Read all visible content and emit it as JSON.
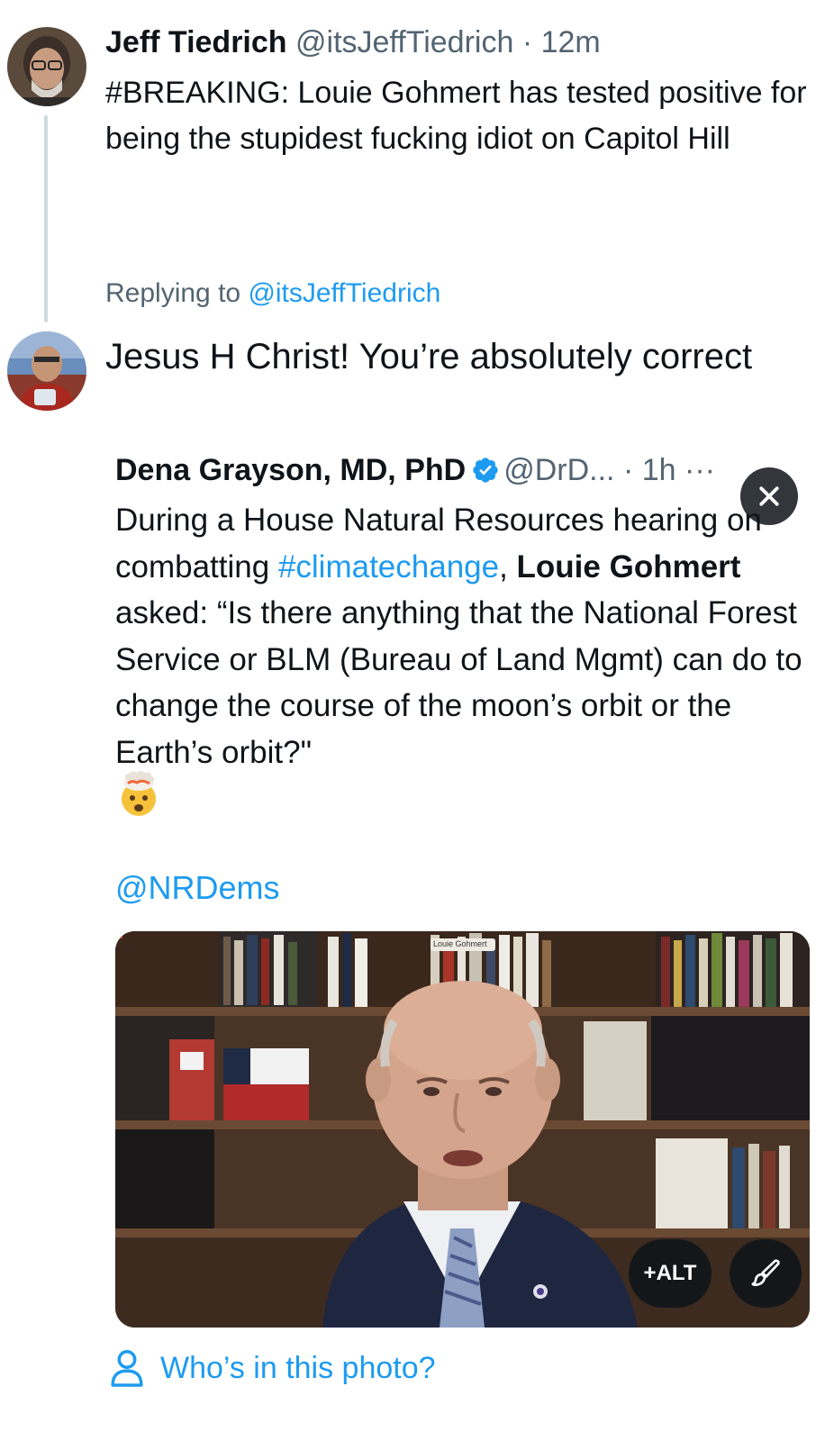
{
  "tweet": {
    "author_name": "Jeff Tiedrich",
    "author_handle": "@itsJeffTiedrich",
    "separator": "·",
    "time": "12m",
    "text": "#BREAKING: Louie Gohmert has tested positive for being the stupidest fucking idiot on Capitol Hill"
  },
  "reply": {
    "replying_prefix": "Replying to ",
    "replying_to": "@itsJeffTiedrich",
    "text": "Jesus H Christ! You’re absolutely correct"
  },
  "quote": {
    "author_name": "Dena Grayson, MD, PhD",
    "author_handle": "@DrD...",
    "separator": "·",
    "time": "1h",
    "more": "···",
    "text_part1": "During a House Natural Resources hearing on combatting ",
    "hashtag": "#climatechange",
    "text_part2": ", ",
    "bold_name": "Louie Gohmert",
    "text_part3": " asked: “Is there anything that the National Forest Service or BLM (Bureau of Land Mgmt) can do to change the course of the moon’s orbit or the Earth’s orbit?\"",
    "mention": "@NRDems"
  },
  "media": {
    "video_label": "Louie Gohmert",
    "alt_label": "+ALT"
  },
  "tag_people_label": "Who’s in this photo?",
  "icons": {
    "verified": "verified-badge-icon",
    "close": "close-icon",
    "edit": "brush-icon",
    "person": "person-icon",
    "emoji": "exploding-head-emoji"
  },
  "colors": {
    "accent": "#1d9bf0",
    "secondary_text": "#536471",
    "primary_text": "#0f1419"
  }
}
